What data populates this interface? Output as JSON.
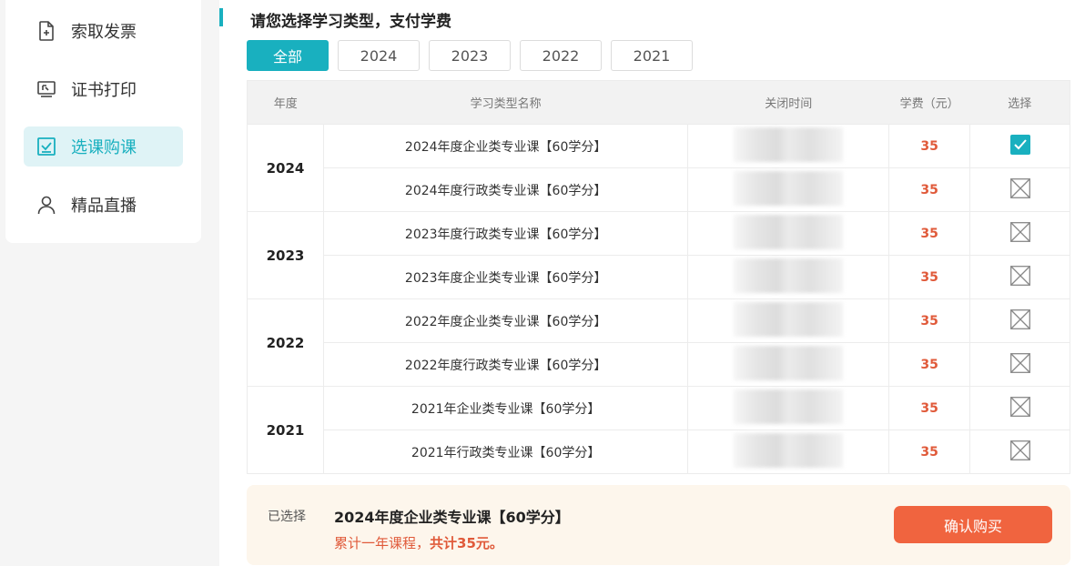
{
  "sidebar": {
    "items": [
      {
        "label": "索取发票",
        "icon": "invoice-add-icon",
        "active": false
      },
      {
        "label": "证书打印",
        "icon": "certificate-print-icon",
        "active": false
      },
      {
        "label": "选课购课",
        "icon": "checkbox-select-icon",
        "active": true
      },
      {
        "label": "精品直播",
        "icon": "user-live-icon",
        "active": false
      }
    ]
  },
  "main": {
    "title": "请您选择学习类型，支付学费",
    "tabs": [
      "全部",
      "2024",
      "2023",
      "2022",
      "2021"
    ],
    "active_tab": "全部"
  },
  "table": {
    "headers": [
      "年度",
      "学习类型名称",
      "关闭时间",
      "学费（元）",
      "选择"
    ],
    "groups": [
      {
        "year": "2024",
        "rows": [
          {
            "name": "2024年度企业类专业课【60学分】",
            "fee": "35",
            "selected": true
          },
          {
            "name": "2024年度行政类专业课【60学分】",
            "fee": "35",
            "selected": false
          }
        ]
      },
      {
        "year": "2023",
        "rows": [
          {
            "name": "2023年度行政类专业课【60学分】",
            "fee": "35",
            "selected": false
          },
          {
            "name": "2023年度企业类专业课【60学分】",
            "fee": "35",
            "selected": false
          }
        ]
      },
      {
        "year": "2022",
        "rows": [
          {
            "name": "2022年度企业类专业课【60学分】",
            "fee": "35",
            "selected": false
          },
          {
            "name": "2022年度行政类专业课【60学分】",
            "fee": "35",
            "selected": false
          }
        ]
      },
      {
        "year": "2021",
        "rows": [
          {
            "name": "2021年企业类专业课【60学分】",
            "fee": "35",
            "selected": false
          },
          {
            "name": "2021年行政类专业课【60学分】",
            "fee": "35",
            "selected": false
          }
        ]
      }
    ]
  },
  "footer": {
    "selected_label": "已选择",
    "selected_name": "2024年度企业类专业课【60学分】",
    "summary_prefix": "累计一年课程，",
    "summary_total": "共计35元。",
    "confirm_label": "确认购买"
  },
  "colors": {
    "accent": "#19b0bf",
    "price": "#e05a3a",
    "confirm": "#f0643f"
  }
}
